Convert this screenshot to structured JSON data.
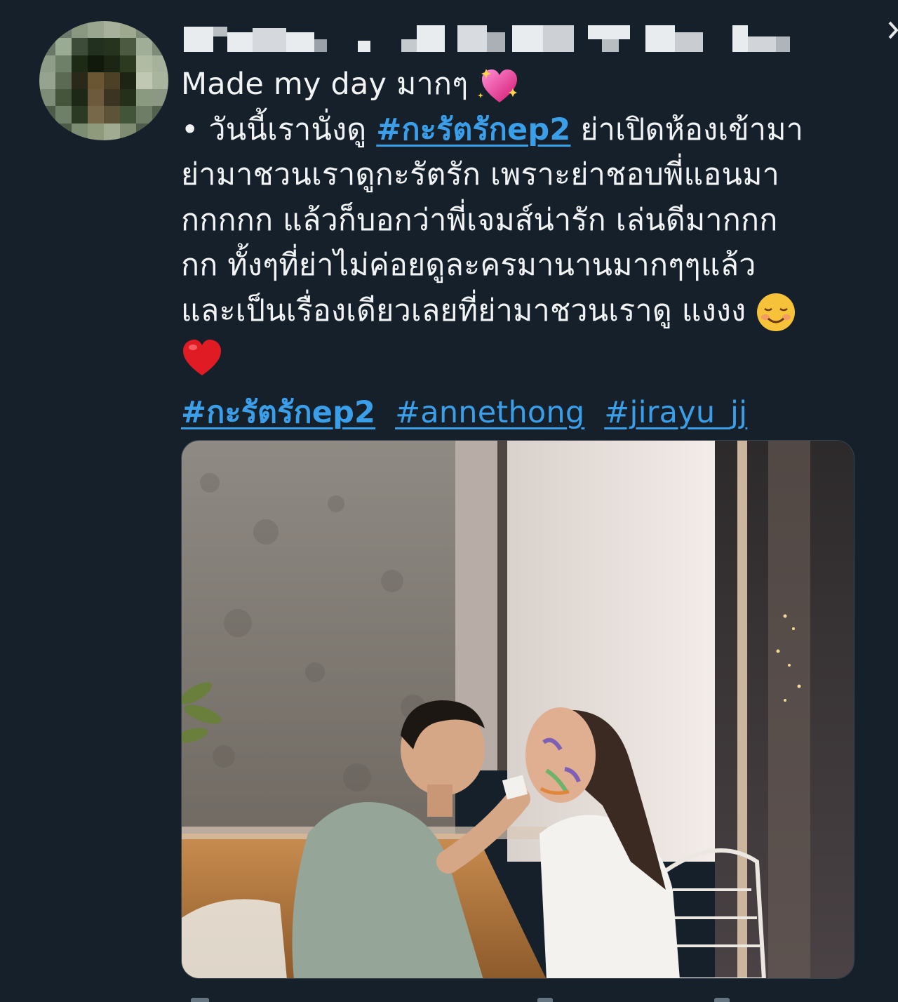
{
  "tweet": {
    "author_name": "",
    "lines": [
      "Made my day มากๆ",
      "• วันนี้เรานั่งดู",
      "ย่าเปิดห้องเข้ามา",
      "ย่ามาชวนเราดูกะรัตรัก เพราะย่าชอบพี่แอนมา",
      "กกกกก แล้วก็บอกว่าพี่เจมส์น่ารัก เล่นดีมากกก",
      "กก ทั้งๆที่ย่าไม่ค่อยดูละครมานานมากๆๆแล้ว",
      "และเป็นเรื่องเดียวเลยที่ย่ามาชวนเราดู แงงง"
    ],
    "inline_hashtag": "#กะรัตรักep2",
    "hashtags": [
      "#กะรัตรักep2",
      "#annethong",
      "#jirayu_jj"
    ],
    "emojis": {
      "sparkling_heart": "sparkling-heart-icon",
      "smiling_face": "smiling-face-icon",
      "red_heart": "red-heart-icon"
    },
    "colors": {
      "background": "#15202b",
      "text": "#e7e9ea",
      "hashtag": "#3a9fe8"
    }
  },
  "media": {
    "type": "photo",
    "icon": "photo-image"
  }
}
